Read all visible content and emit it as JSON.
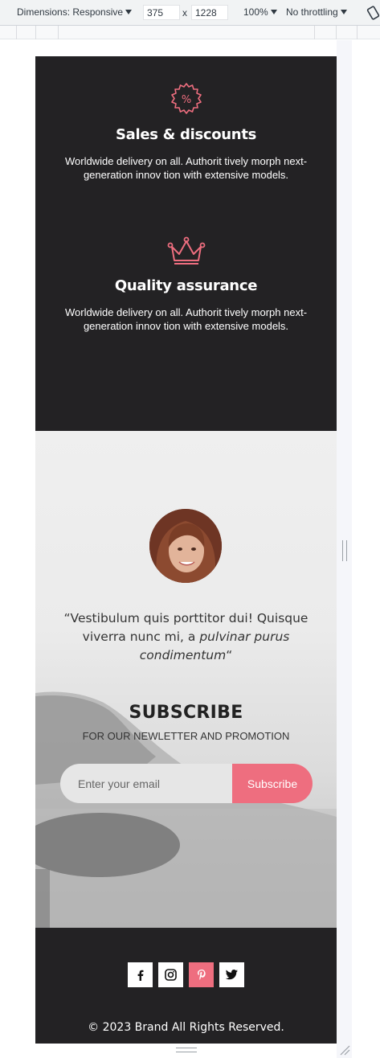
{
  "devtools": {
    "dimensions_label": "Dimensions: Responsive",
    "width": "375",
    "height": "1228",
    "times": "x",
    "zoom": "100%",
    "throttling": "No throttling"
  },
  "features": [
    {
      "icon": "discount-badge-icon",
      "title": "Sales & discounts",
      "text": "Worldwide delivery on all. Authorit tively morph next-generation innov tion with extensive models."
    },
    {
      "icon": "crown-icon",
      "title": "Quality assurance",
      "text": "Worldwide delivery on all. Authorit tively morph next-generation innov tion with extensive models."
    }
  ],
  "testimonial": {
    "quote_open": "“",
    "quote_plain": "Vestibulum quis porttitor dui! Quisque viverra nunc mi, a ",
    "quote_italic": "pulvinar purus condimentum",
    "quote_close": "“"
  },
  "subscribe": {
    "title": "SUBSCRIBE",
    "caption": "FOR OUR NEWLETTER AND PROMOTION",
    "placeholder": "Enter your email",
    "button_label": "Subscribe"
  },
  "footer": {
    "socials": [
      "facebook-icon",
      "instagram-icon",
      "pinterest-icon",
      "twitter-icon"
    ],
    "active_social": "pinterest-icon",
    "copyright": "© 2023 Brand All Rights Reserved."
  },
  "colors": {
    "accent": "#ee6e7f",
    "dark": "#232224",
    "light_text": "#ffffff"
  }
}
